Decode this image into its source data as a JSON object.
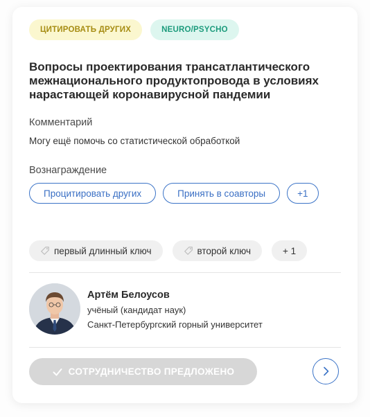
{
  "tags": [
    {
      "label": "ЦИТИРОВАТЬ ДРУГИХ",
      "color": "#a68c12",
      "background": "#fbf7cf"
    },
    {
      "label": "NEURO/PSYCHO",
      "color": "#1c9b7c",
      "background": "#ddf6ef"
    }
  ],
  "title": "Вопросы проектирования трансатлантического межнационального продуктопровода в условиях нарастающей коронавирусной пандемии",
  "comment": {
    "label": "Комментарий",
    "text": "Могу ещё помочь со статистической обработкой"
  },
  "reward": {
    "label": "Вознаграждение",
    "options": [
      "Процитировать других",
      "Принять в соавторы"
    ],
    "more": "+1"
  },
  "keywords": {
    "items": [
      "первый длинный ключ",
      "второй ключ"
    ],
    "more": "+ 1",
    "icon": "tag-icon"
  },
  "author": {
    "name": "Артём Белоусов",
    "role": "учёный (кандидат наук)",
    "organization": "Санкт-Петербургский горный университет"
  },
  "actions": {
    "collaboration_status": "СОТРУДНИЧЕСТВО ПРЕДЛОЖЕНО",
    "next_icon": "chevron-right-icon"
  },
  "colors": {
    "accent": "#3a73c7",
    "disabled_button": "#d7d7d7"
  }
}
